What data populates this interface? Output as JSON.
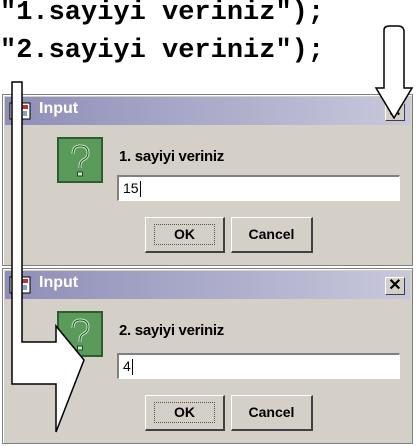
{
  "code": {
    "line1": "\"1.sayiyi veriniz\");",
    "line2": "\"2.sayiyi veriniz\");"
  },
  "dialogs": [
    {
      "title": "Input",
      "close_label": "✕",
      "prompt": "1. sayiyi veriniz",
      "input_value": "15",
      "ok_label": "OK",
      "cancel_label": "Cancel",
      "icon": "question-icon"
    },
    {
      "title": "Input",
      "close_label": "✕",
      "prompt": "2. sayiyi veriniz",
      "input_value": "4",
      "ok_label": "OK",
      "cancel_label": "Cancel",
      "icon": "question-icon"
    }
  ],
  "colors": {
    "dialog_bg": "#d4d0c8",
    "icon_green": "#5a9a5a"
  }
}
